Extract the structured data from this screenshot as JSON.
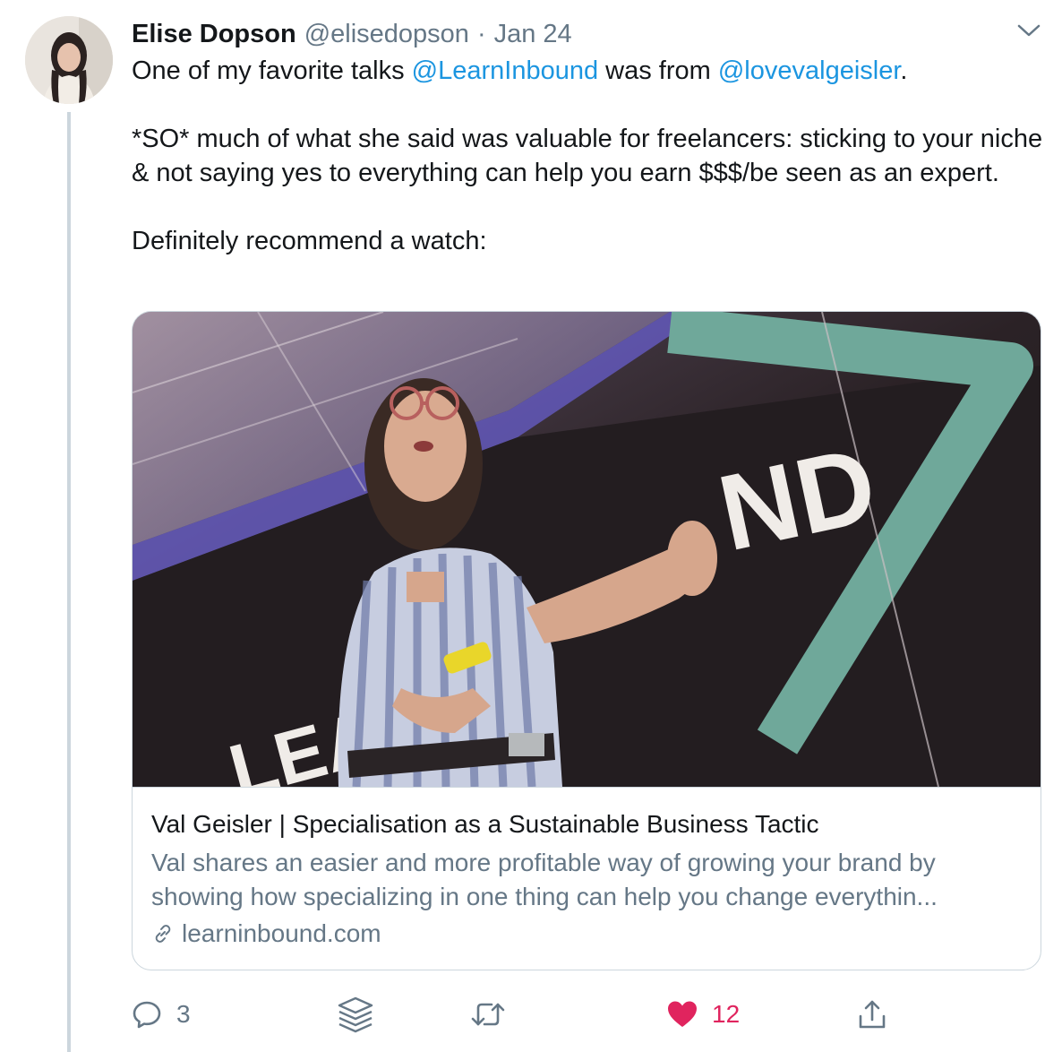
{
  "tweet": {
    "author_name": "Elise Dopson",
    "author_handle": "@elisedopson",
    "separator": "·",
    "date": "Jan 24",
    "text": {
      "line1_before": "One of my favorite talks ",
      "mention1": "@LearnInbound",
      "line1_middle": " was from ",
      "mention2": "@lovevalgeisler",
      "line1_after": ".",
      "paragraph2": "*SO* much of what she said was valuable for freelancers:  sticking to your niche & not saying yes to everything can help you earn $$$/be seen as an expert.",
      "paragraph3": "Definitely recommend a watch:"
    },
    "card": {
      "title": "Val Geisler | Specialisation as a Sustainable Business Tactic",
      "description_line1": "Val shares an easier and more profitable way of growing your brand by",
      "description_line2": "showing how specializing in one thing can help you change everythin...",
      "domain": "learninbound.com",
      "image_sign_text": "ND",
      "image_sign_text2": "LEAR"
    },
    "actions": {
      "reply_count": "3",
      "like_count": "12"
    }
  },
  "icons": {
    "more": "chevron-down-icon",
    "reply": "speech-bubble-icon",
    "layers": "stack-layers-icon",
    "retweet": "retweet-icon",
    "like": "heart-icon",
    "share": "share-upload-icon",
    "link": "link-chain-icon"
  },
  "colors": {
    "link_blue": "#1b95e0",
    "secondary_gray": "#657786",
    "like_red": "#e0245e",
    "border": "#ccd6dd"
  }
}
